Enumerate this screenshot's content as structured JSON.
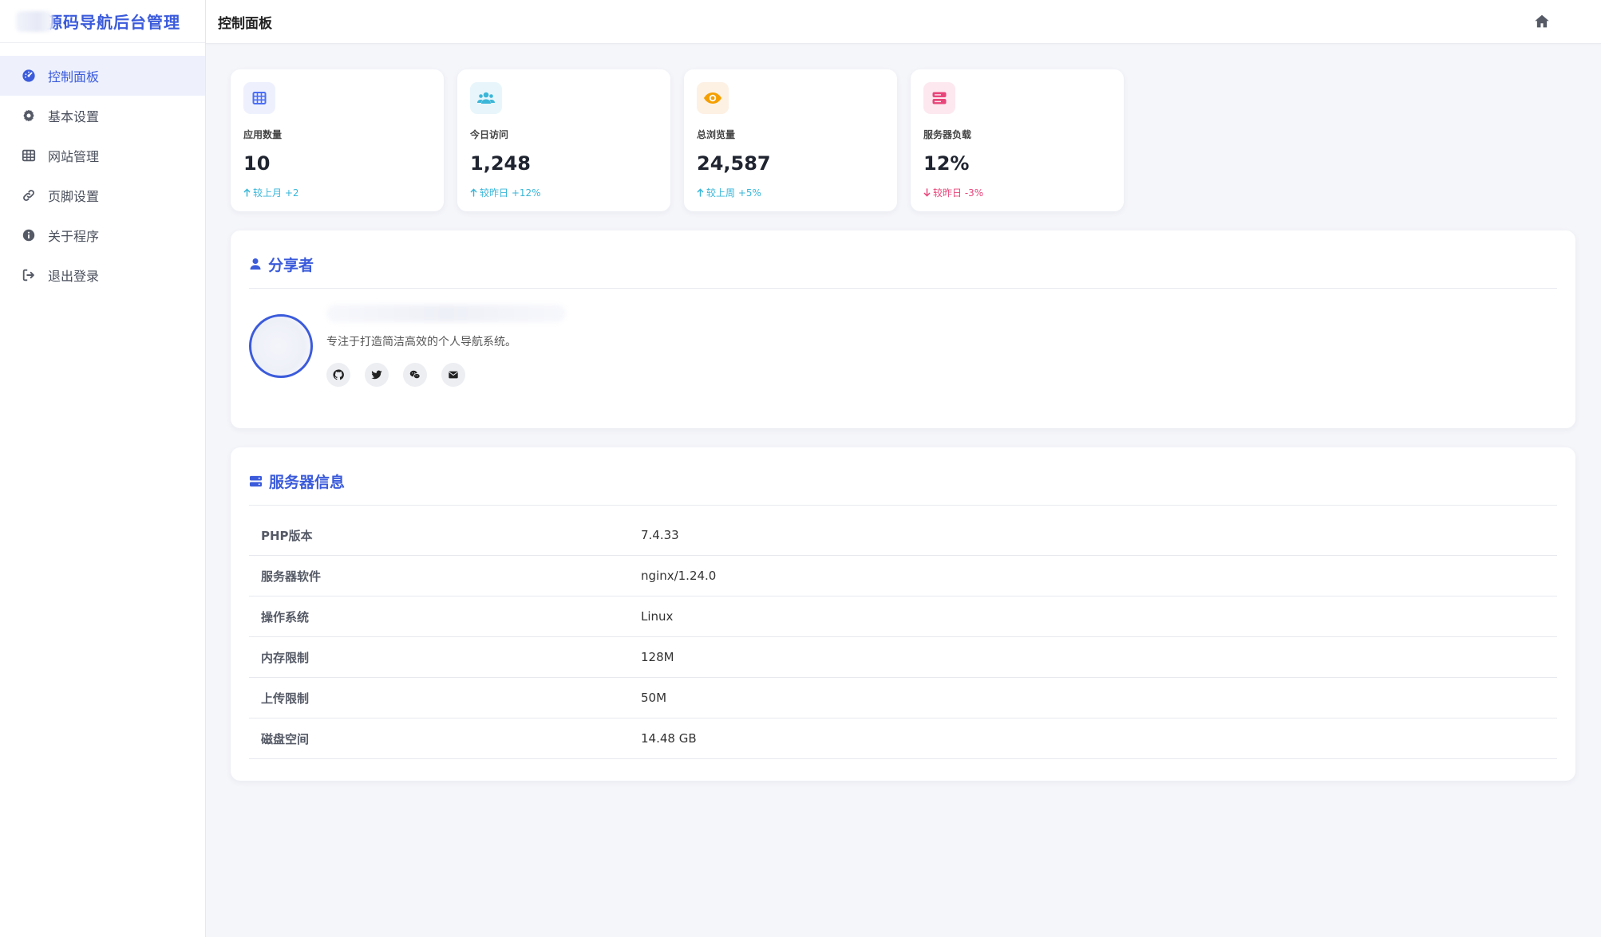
{
  "app": {
    "brand_title": "源码导航后台管理",
    "accent": "#3b5bdb"
  },
  "sidebar": {
    "items": [
      {
        "label": "控制面板",
        "icon": "dashboard-icon",
        "active": true
      },
      {
        "label": "基本设置",
        "icon": "gear-icon",
        "active": false
      },
      {
        "label": "网站管理",
        "icon": "table-icon",
        "active": false
      },
      {
        "label": "页脚设置",
        "icon": "link-icon",
        "active": false
      },
      {
        "label": "关于程序",
        "icon": "info-icon",
        "active": false
      },
      {
        "label": "退出登录",
        "icon": "logout-icon",
        "active": false
      }
    ]
  },
  "header": {
    "title": "控制面板",
    "home_icon": "home-icon"
  },
  "stats": [
    {
      "label": "应用数量",
      "value": "10",
      "trend": "较上月 +2",
      "direction": "up",
      "icon": "grid-icon",
      "icon_color": "#4c6ef5",
      "icon_bg": "#eef1fd"
    },
    {
      "label": "今日访问",
      "value": "1,248",
      "trend": "较昨日 +12%",
      "direction": "up",
      "icon": "users-icon",
      "icon_color": "#3bb6d8",
      "icon_bg": "#e8f6fb"
    },
    {
      "label": "总浏览量",
      "value": "24,587",
      "trend": "较上周 +5%",
      "direction": "up",
      "icon": "eye-icon",
      "icon_color": "#f59f00",
      "icon_bg": "#fdf1e4"
    },
    {
      "label": "服务器负载",
      "value": "12%",
      "trend": "较昨日 -3%",
      "direction": "down",
      "icon": "server-icon",
      "icon_color": "#e8457a",
      "icon_bg": "#fde8ef"
    }
  ],
  "share": {
    "title": "分享者",
    "description": "专注于打造简洁高效的个人导航系统。",
    "socials": [
      "github-icon",
      "twitter-icon",
      "wechat-icon",
      "email-icon"
    ]
  },
  "server": {
    "title": "服务器信息",
    "rows": [
      {
        "key": "PHP版本",
        "value": "7.4.33"
      },
      {
        "key": "服务器软件",
        "value": "nginx/1.24.0"
      },
      {
        "key": "操作系统",
        "value": "Linux"
      },
      {
        "key": "内存限制",
        "value": "128M"
      },
      {
        "key": "上传限制",
        "value": "50M"
      },
      {
        "key": "磁盘空间",
        "value": "14.48 GB"
      }
    ]
  }
}
